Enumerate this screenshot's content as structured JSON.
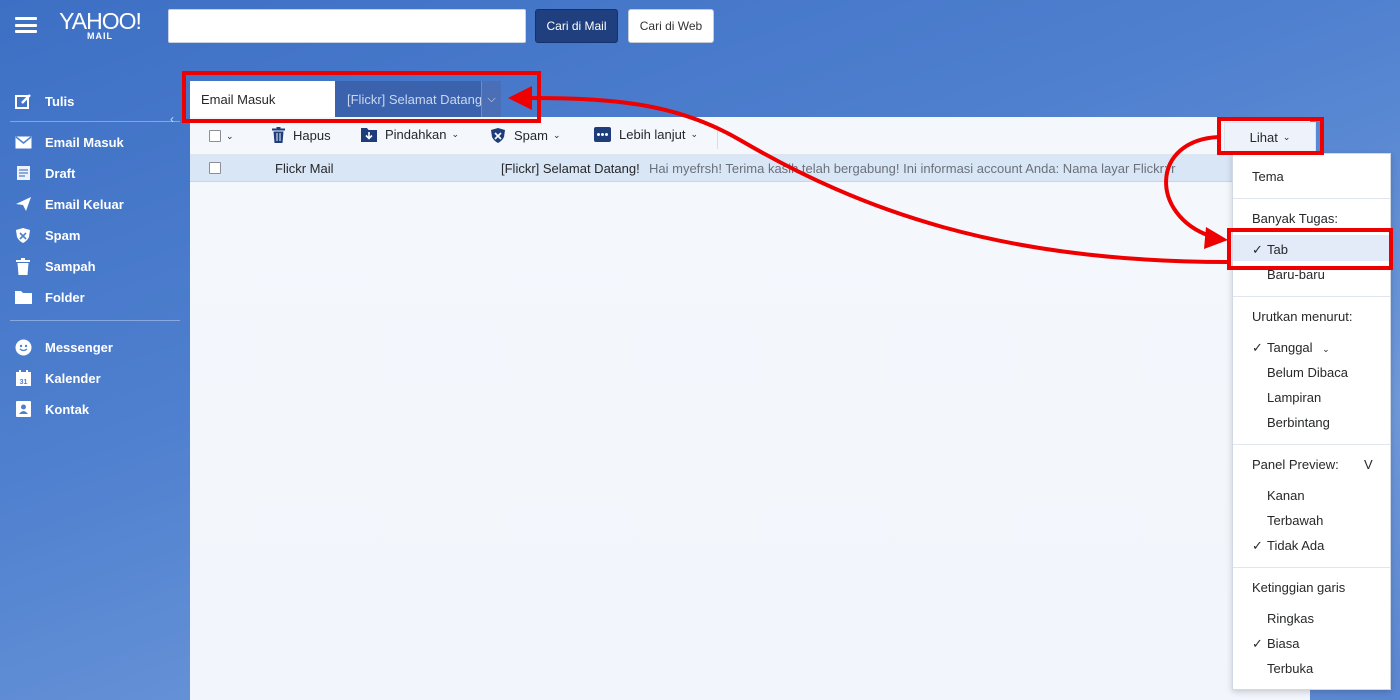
{
  "header": {
    "logo_text": "YAHOO!",
    "logo_sub": "MAIL",
    "search_placeholder": "",
    "search_mail_label": "Cari di Mail",
    "search_web_label": "Cari di Web"
  },
  "sidebar": {
    "compose": "Tulis",
    "items": [
      {
        "label": "Email Masuk",
        "icon": "envelope-icon"
      },
      {
        "label": "Draft",
        "icon": "draft-icon"
      },
      {
        "label": "Email Keluar",
        "icon": "paper-plane-icon"
      },
      {
        "label": "Spam",
        "icon": "shield-icon"
      },
      {
        "label": "Sampah",
        "icon": "trash-icon"
      },
      {
        "label": "Folder",
        "icon": "folder-icon"
      }
    ],
    "apps": [
      {
        "label": "Messenger",
        "icon": "smiley-icon"
      },
      {
        "label": "Kalender",
        "icon": "calendar-icon"
      },
      {
        "label": "Kontak",
        "icon": "contact-icon"
      }
    ]
  },
  "tabs": {
    "active": "Email Masuk",
    "other": "[Flickr] Selamat Datang"
  },
  "toolbar": {
    "delete": "Hapus",
    "move": "Pindahkan",
    "spam": "Spam",
    "more": "Lebih lanjut",
    "view": "Lihat"
  },
  "messages": [
    {
      "from": "Flickr Mail",
      "subject": "[Flickr] Selamat Datang!",
      "snippet": "Hai myefrsh! Terima kasih telah bergabung! Ini informasi account Anda: Nama layar Flickr: r"
    }
  ],
  "view_menu": {
    "theme": "Tema",
    "multitask_heading": "Banyak Tugas:",
    "multitask_tab": "Tab",
    "multitask_recent": "Baru-baru",
    "sort_heading": "Urutkan menurut:",
    "sort_date": "Tanggal",
    "sort_unread": "Belum Dibaca",
    "sort_attachment": "Lampiran",
    "sort_starred": "Berbintang",
    "preview_heading": "Panel Preview:",
    "preview_shortcut": "V",
    "preview_right": "Kanan",
    "preview_bottom": "Terbawah",
    "preview_none": "Tidak Ada",
    "line_heading": "Ketinggian garis",
    "line_compact": "Ringkas",
    "line_normal": "Biasa",
    "line_open": "Terbuka",
    "checkmark": "✓"
  },
  "colors": {
    "annotation": "#e00000",
    "accent": "#1f3f7e"
  }
}
